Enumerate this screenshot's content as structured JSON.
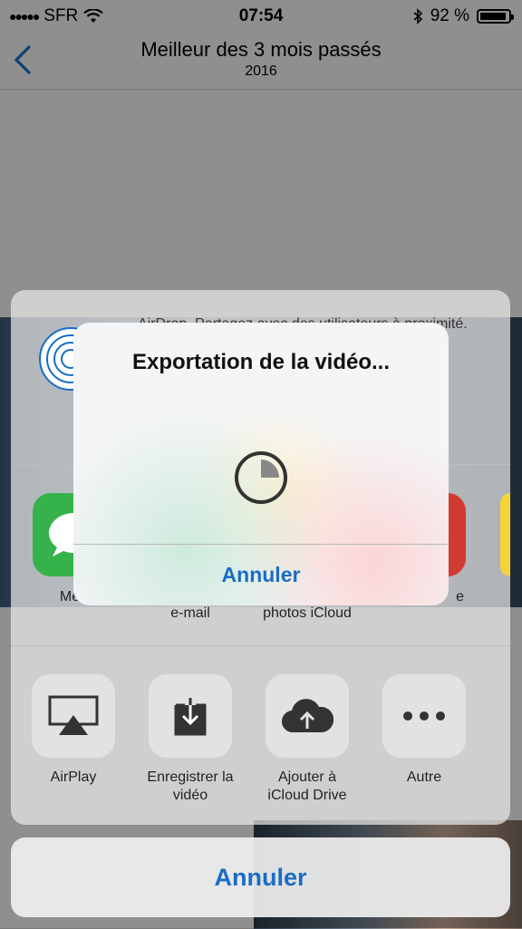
{
  "statusbar": {
    "carrier": "SFR",
    "time": "07:54",
    "battery_label": "92 %",
    "battery_level": 0.92
  },
  "navbar": {
    "title": "Meilleur des 3 mois passés",
    "subtitle": "2016"
  },
  "share_sheet": {
    "airdrop_text": "AirDrop. Partagez avec des utilisateurs à proximité. Activez le Wi-Fi et Bluetooth pour un partage ou",
    "app_labels": [
      "Mess",
      "e-mail",
      "photos iCloud",
      "e"
    ],
    "actions": [
      {
        "label_line1": "AirPlay",
        "label_line2": "",
        "icon": "airplay-icon"
      },
      {
        "label_line1": "Enregistrer la",
        "label_line2": "vidéo",
        "icon": "save-video-icon"
      },
      {
        "label_line1": "Ajouter à",
        "label_line2": "iCloud Drive",
        "icon": "icloud-upload-icon"
      },
      {
        "label_line1": "Autre",
        "label_line2": "",
        "icon": "more-icon"
      }
    ],
    "cancel_label": "Annuler"
  },
  "alert": {
    "title": "Exportation de la vidéo...",
    "progress": 0.25,
    "button_label": "Annuler"
  },
  "colors": {
    "accent": "#1a6dc4"
  }
}
